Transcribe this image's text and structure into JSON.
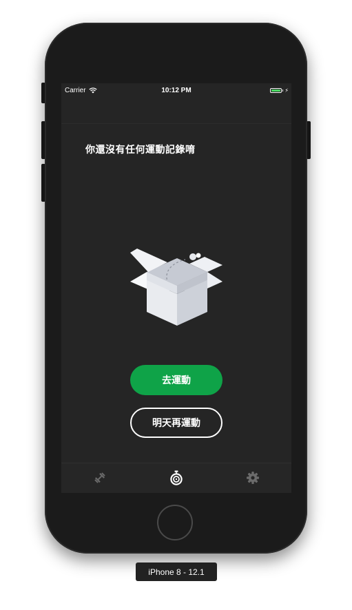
{
  "status_bar": {
    "carrier": "Carrier",
    "time": "10:12 PM",
    "battery_color": "#4cd964"
  },
  "empty_state": {
    "message": "你還沒有任何運動記錄唷",
    "illustration": "open-box"
  },
  "actions": {
    "primary_label": "去運動",
    "secondary_label": "明天再運動",
    "primary_color": "#0fa348"
  },
  "tab_bar": {
    "tabs": [
      {
        "icon": "dumbbell-icon",
        "active": false
      },
      {
        "icon": "stopwatch-icon",
        "active": true
      },
      {
        "icon": "gear-icon",
        "active": false
      }
    ]
  },
  "device": {
    "label": "iPhone 8 - 12.1"
  }
}
